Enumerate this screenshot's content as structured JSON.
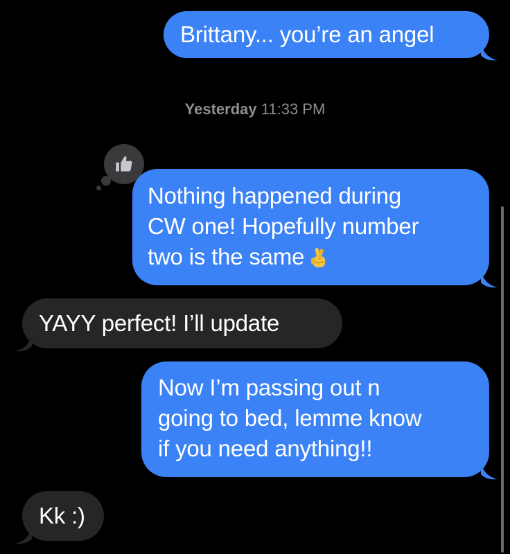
{
  "conversation": {
    "timestamp": {
      "day": "Yesterday",
      "time": "11:33 PM"
    },
    "messages": [
      {
        "direction": "sent",
        "lines": [
          "Brittany... you’re an angel"
        ]
      },
      {
        "direction": "sent",
        "lines": [
          "Nothing happened during",
          "CW one! Hopefully number",
          "two is the same"
        ],
        "emoji": "crossed-fingers",
        "tapback": "thumbs-up"
      },
      {
        "direction": "received",
        "lines": [
          "YAYY perfect! I’ll update"
        ]
      },
      {
        "direction": "sent",
        "lines": [
          "Now I’m passing out n",
          "going to bed, lemme know",
          "if you need anything!!"
        ]
      },
      {
        "direction": "received",
        "lines": [
          "Kk :)"
        ]
      }
    ]
  },
  "colors": {
    "sent_bubble": "#3b82f6",
    "received_bubble": "#262628",
    "background": "#000000",
    "timestamp": "#8e8e93"
  }
}
